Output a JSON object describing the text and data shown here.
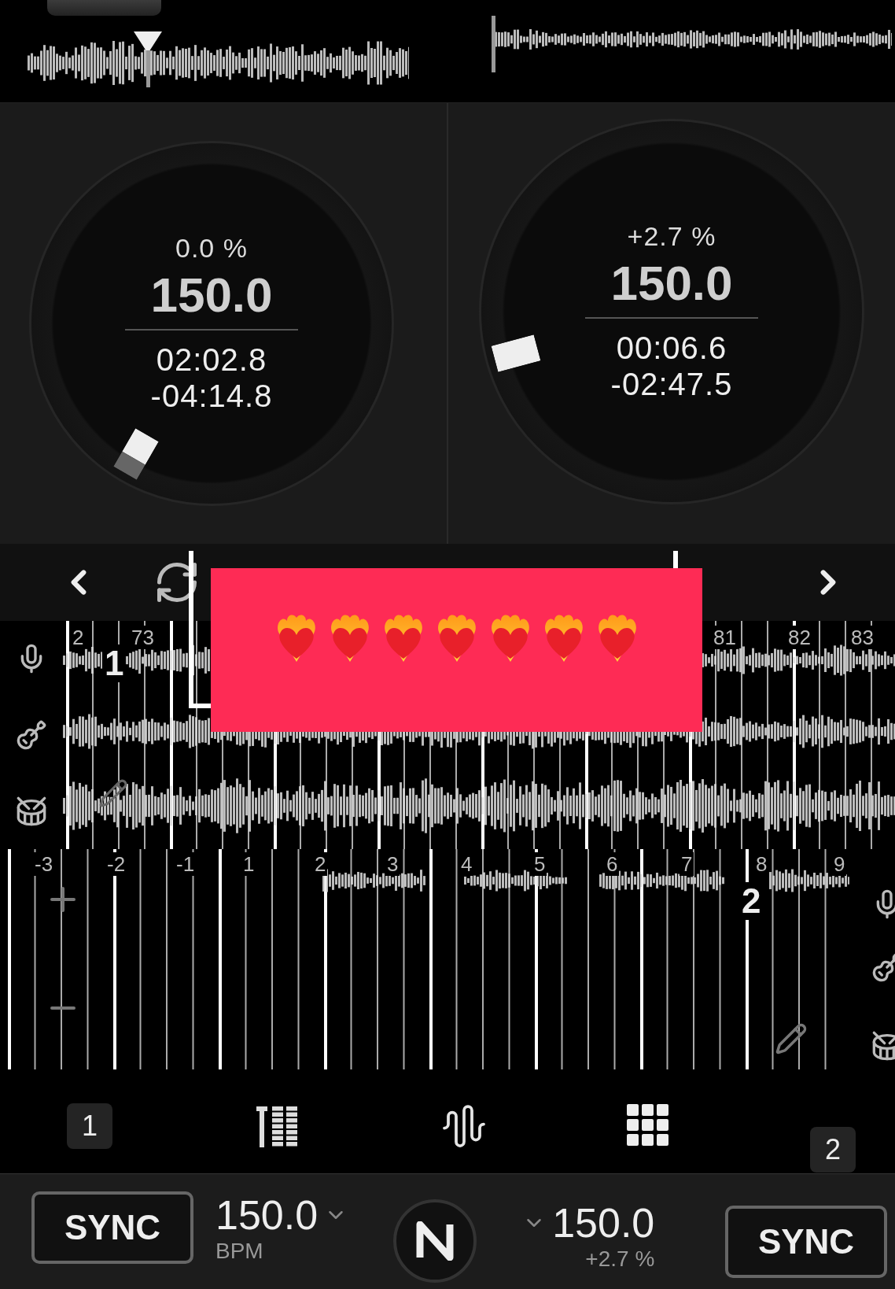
{
  "decks": [
    {
      "pitch": "0.0 %",
      "bpm": "150.0",
      "elapsed": "02:02.8",
      "remaining": "-04:14.8"
    },
    {
      "pitch": "+2.7 %",
      "bpm": "150.0",
      "elapsed": "00:06.6",
      "remaining": "-02:47.5"
    }
  ],
  "track_waveform": {
    "bar_numbers": [
      "2",
      "73",
      "81",
      "82",
      "83"
    ],
    "marker": "1"
  },
  "lower_waveform": {
    "bar_numbers": [
      "-3",
      "-2",
      "-1",
      "1",
      "2",
      "3",
      "4",
      "5",
      "6",
      "7",
      "8",
      "9"
    ],
    "marker": "2"
  },
  "tabs": [
    {
      "kind": "deck",
      "label": "1"
    },
    {
      "kind": "mixer"
    },
    {
      "kind": "waveform"
    },
    {
      "kind": "pads"
    },
    {
      "kind": "deck",
      "label": "2"
    }
  ],
  "bottom_bar": {
    "left": {
      "sync": "SYNC",
      "bpm": "150.0",
      "unit": "BPM"
    },
    "right": {
      "sync": "SYNC",
      "bpm": "150.0",
      "pitch": "+2.7 %"
    }
  },
  "sticker": {
    "hearts": [
      {
        "kind": "fire-heart"
      },
      {
        "kind": "fire-heart"
      },
      {
        "kind": "fire-heart"
      },
      {
        "kind": "fire-heart"
      },
      {
        "kind": "fire-heart"
      },
      {
        "kind": "fire-heart"
      },
      {
        "kind": "fire-heart"
      }
    ]
  }
}
